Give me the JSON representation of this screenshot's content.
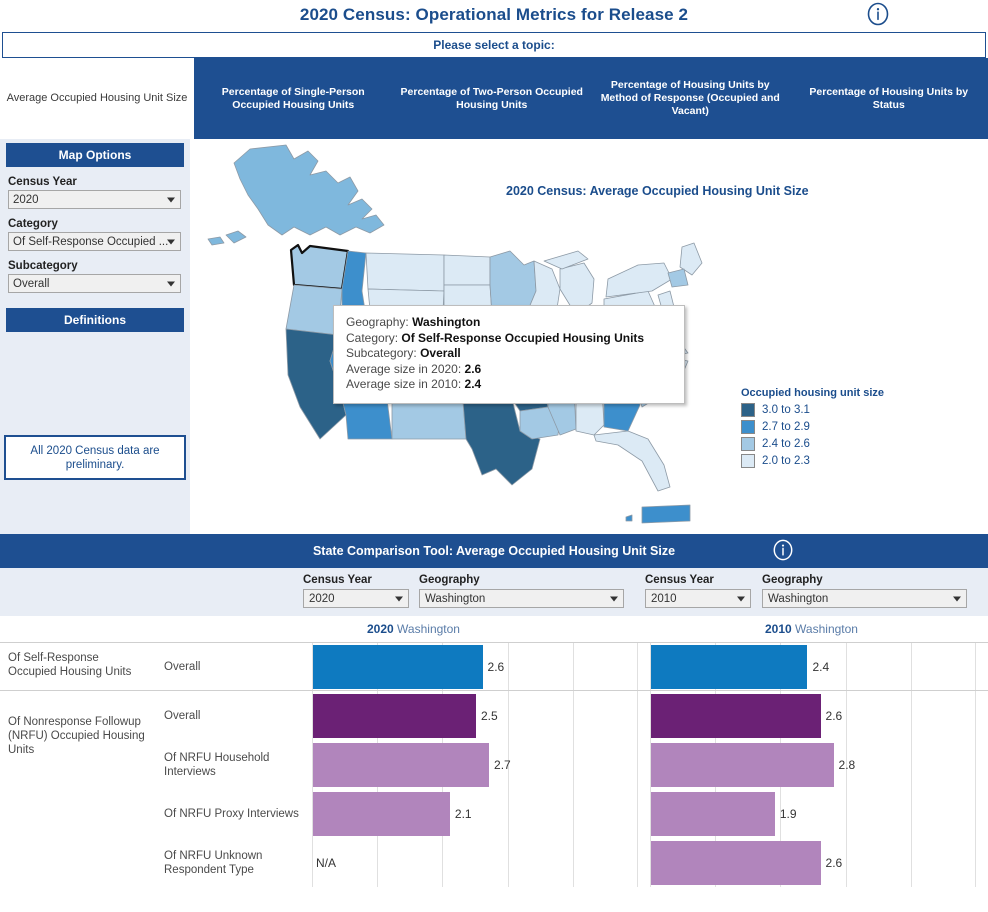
{
  "header": {
    "title": "2020 Census: Operational Metrics for Release 2",
    "info_icon": "info-icon"
  },
  "topic_bar": {
    "label": "Please select a topic:"
  },
  "tabs": [
    {
      "label": "Average Occupied Housing Unit Size",
      "active": true
    },
    {
      "label": "Percentage of Single-Person Occupied Housing Units",
      "active": false
    },
    {
      "label": "Percentage of Two-Person Occupied Housing Units",
      "active": false
    },
    {
      "label": "Percentage of Housing Units by Method of Response (Occupied and Vacant)",
      "active": false
    },
    {
      "label": "Percentage of Housing Units by Status",
      "active": false
    }
  ],
  "sidebar": {
    "panel_title": "Map Options",
    "census_year_label": "Census Year",
    "census_year_value": "2020",
    "category_label": "Category",
    "category_value": "Of Self-Response Occupied ...",
    "subcategory_label": "Subcategory",
    "subcategory_value": "Overall",
    "definitions_label": "Definitions",
    "preliminary_note": "All 2020 Census data are preliminary."
  },
  "map": {
    "title": "2020 Census: Average Occupied Housing Unit Size",
    "tooltip": {
      "geography_key": "Geography:",
      "geography_value": "Washington",
      "category_key": "Category:",
      "category_value": "Of Self-Response Occupied Housing Units",
      "subcategory_key": "Subcategory:",
      "subcategory_value": "Overall",
      "size2020_key": "Average size in 2020:",
      "size2020_value": "2.6",
      "size2010_key": "Average size in 2010:",
      "size2010_value": "2.4"
    },
    "legend": {
      "title": "Occupied housing unit size",
      "items": [
        {
          "label": "3.0 to 3.1",
          "color": "#2c6288"
        },
        {
          "label": "2.7 to 2.9",
          "color": "#3d8fcc"
        },
        {
          "label": "2.4 to 2.6",
          "color": "#a3c9e4"
        },
        {
          "label": "2.0 to 2.3",
          "color": "#dceaf5"
        }
      ]
    },
    "selected_state": "Washington"
  },
  "comparison": {
    "bar_title": "State Comparison Tool: Average Occupied Housing Unit Size",
    "info_icon": "info-icon",
    "controls": [
      {
        "label": "Census Year",
        "value": "2020"
      },
      {
        "label": "Geography",
        "value": "Washington"
      },
      {
        "label": "Census Year",
        "value": "2010"
      },
      {
        "label": "Geography",
        "value": "Washington"
      }
    ],
    "left_head_year": "2020",
    "left_head_geo": "Washington",
    "right_head_year": "2010",
    "right_head_geo": "Washington"
  },
  "chart_data": {
    "type": "bar",
    "title": "State Comparison Tool: Average Occupied Housing Unit Size",
    "xlabel": "",
    "ylabel": "",
    "xlim": [
      0,
      5
    ],
    "grid": true,
    "legend": "none",
    "categories": [
      "Of Self-Response Occupied Housing Units",
      "Of Nonresponse Followup (NRFU) Occupied Housing Units"
    ],
    "rows": [
      {
        "category": "Of Self-Response Occupied Housing Units",
        "subcategory": "Overall",
        "color": "#0e7ac0",
        "left_value": 2.6,
        "left_label": "2.6",
        "right_value": 2.4,
        "right_label": "2.4"
      },
      {
        "category": "Of Nonresponse Followup (NRFU) Occupied Housing Units",
        "subcategory": "Overall",
        "color": "#6b2175",
        "left_value": 2.5,
        "left_label": "2.5",
        "right_value": 2.6,
        "right_label": "2.6"
      },
      {
        "category": "",
        "subcategory": "Of NRFU Household Interviews",
        "color": "#b185bc",
        "left_value": 2.7,
        "left_label": "2.7",
        "right_value": 2.8,
        "right_label": "2.8"
      },
      {
        "category": "",
        "subcategory": "Of NRFU Proxy Interviews",
        "color": "#b185bc",
        "left_value": 2.1,
        "left_label": "2.1",
        "right_value": 1.9,
        "right_label": "1.9"
      },
      {
        "category": "",
        "subcategory": "Of NRFU Unknown Respondent Type",
        "color": "#b185bc",
        "left_value": null,
        "left_label": "N/A",
        "right_value": 2.6,
        "right_label": "2.6"
      }
    ],
    "series": [
      {
        "name": "2020 Washington",
        "values": [
          2.6,
          2.5,
          2.7,
          2.1,
          null
        ]
      },
      {
        "name": "2010 Washington",
        "values": [
          2.4,
          2.6,
          2.8,
          1.9,
          2.6
        ]
      }
    ]
  },
  "colors": {
    "brand_blue": "#1e4f91",
    "panel_bg": "#e8edf5",
    "bar_blue": "#0e7ac0",
    "bar_purple": "#6b2175",
    "bar_light_purple": "#b185bc"
  }
}
